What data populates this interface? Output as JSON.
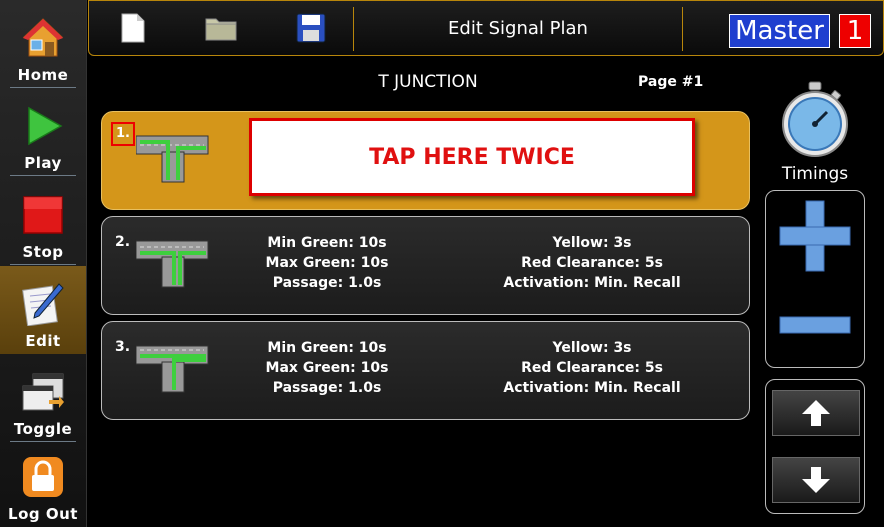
{
  "sidebar": {
    "items": [
      {
        "label": "Home",
        "icon": "home-icon"
      },
      {
        "label": "Play",
        "icon": "play-icon"
      },
      {
        "label": "Stop",
        "icon": "stop-icon"
      },
      {
        "label": "Edit",
        "icon": "edit-icon",
        "active": true
      },
      {
        "label": "Toggle",
        "icon": "toggle-icon"
      },
      {
        "label": "Log Out",
        "icon": "lock-icon"
      }
    ]
  },
  "header": {
    "title": "Edit Signal Plan",
    "master_label": "Master",
    "master_number": "1",
    "accent": "#b8860b"
  },
  "plan": {
    "name": "T JUNCTION",
    "page": "Page #1"
  },
  "phases": [
    {
      "number": "1.",
      "selected": true,
      "tap_text": "TAP HERE TWICE"
    },
    {
      "number": "2.",
      "min_green": "Min Green: 10s",
      "max_green": "Max Green: 10s",
      "passage": "Passage: 1.0s",
      "yellow": "Yellow: 3s",
      "red_clearance": "Red Clearance: 5s",
      "activation": "Activation: Min. Recall"
    },
    {
      "number": "3.",
      "min_green": "Min Green: 10s",
      "max_green": "Max Green: 10s",
      "passage": "Passage: 1.0s",
      "yellow": "Yellow: 3s",
      "red_clearance": "Red Clearance: 5s",
      "activation": "Activation: Min. Recall"
    }
  ],
  "right_panel": {
    "timings_label": "Timings"
  }
}
